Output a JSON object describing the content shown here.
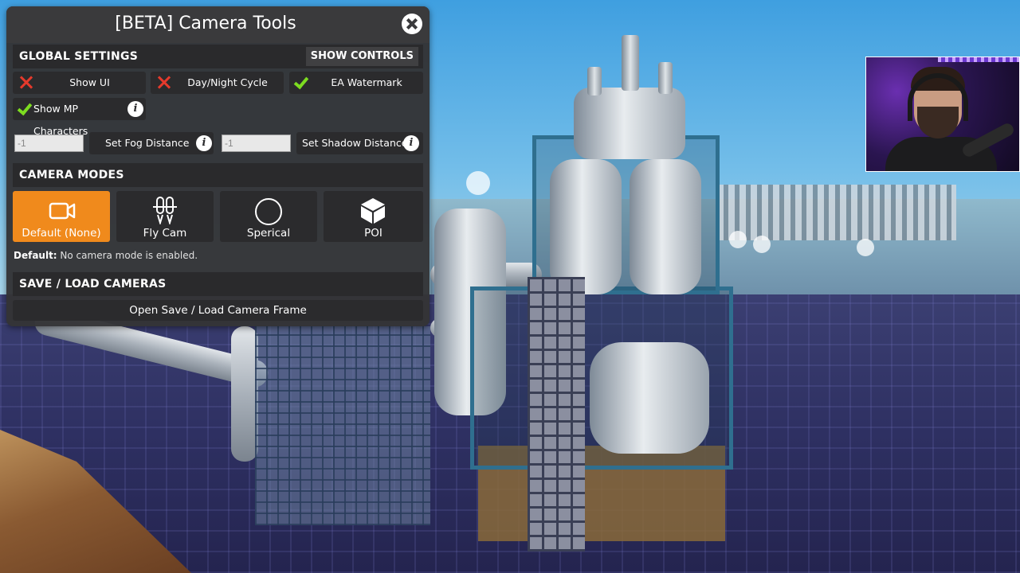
{
  "window": {
    "title": "[BETA] Camera Tools",
    "close_icon": "close-icon"
  },
  "global_settings": {
    "header": "GLOBAL SETTINGS",
    "show_controls_label": "SHOW CONTROLS",
    "toggles": [
      {
        "label": "Show UI",
        "state": "off",
        "icon": "x-icon"
      },
      {
        "label": "Day/Night Cycle",
        "state": "off",
        "icon": "x-icon"
      },
      {
        "label": "EA Watermark",
        "state": "on",
        "icon": "check-icon"
      },
      {
        "label": "Show MP Characters",
        "state": "on",
        "icon": "check-icon"
      }
    ],
    "fog": {
      "value": "-1",
      "button_label": "Set Fog Distance"
    },
    "shadow": {
      "value": "-1",
      "button_label": "Set Shadow Distance"
    }
  },
  "camera_modes": {
    "header": "CAMERA MODES",
    "modes": [
      {
        "label": "Default (None)",
        "icon": "video-camera-icon",
        "active": true
      },
      {
        "label": "Fly Cam",
        "icon": "jetpack-icon",
        "active": false
      },
      {
        "label": "Sperical",
        "icon": "circle-icon",
        "active": false
      },
      {
        "label": "POI",
        "icon": "cube-icon",
        "active": false
      }
    ],
    "help_title": "Default:",
    "help_text": " No camera mode is enabled."
  },
  "save_load": {
    "header": "SAVE / LOAD CAMERAS",
    "open_button_label": "Open Save / Load Camera Frame"
  },
  "colors": {
    "accent_orange": "#f08a1c",
    "check_green": "#7ddc20",
    "cross_red": "#e53a2c"
  }
}
